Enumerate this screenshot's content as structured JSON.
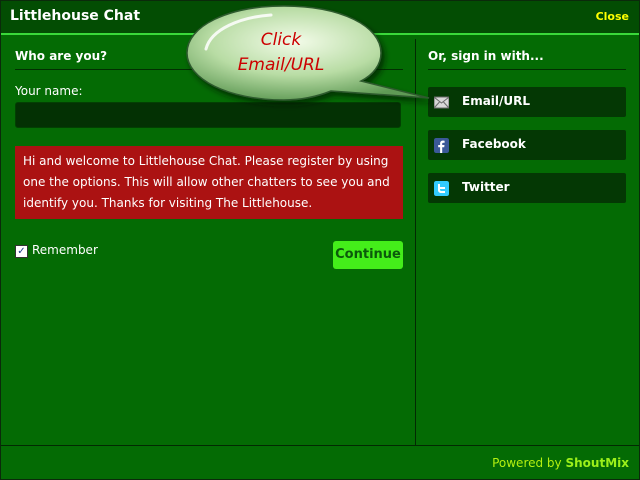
{
  "window": {
    "title": "Littlehouse Chat",
    "close_label": "Close"
  },
  "left": {
    "heading": "Who are you?",
    "name_label": "Your name:",
    "name_value": "",
    "welcome_message": "Hi and welcome to Littlehouse Chat. Please register by using one the options. This will allow other chatters to see you and identify you. Thanks for visiting The Littlehouse.",
    "remember_label": "Remember",
    "remember_checked": true,
    "continue_label": "Continue"
  },
  "right": {
    "heading": "Or, sign in with...",
    "options": [
      {
        "label": "Email/URL",
        "icon": "envelope-icon"
      },
      {
        "label": "Facebook",
        "icon": "facebook-icon"
      },
      {
        "label": "Twitter",
        "icon": "twitter-icon"
      }
    ]
  },
  "footer": {
    "powered_prefix": "Powered by",
    "brand": "ShoutMix"
  },
  "callout": {
    "line1": "Click",
    "line2": "Email/URL"
  },
  "colors": {
    "background": "#046b04",
    "titlebar": "#034d03",
    "accent_line": "#3ad93a",
    "welcome_box": "#ab1212",
    "continue_button": "#44ee1a",
    "close_link": "#ffff00",
    "footer_text": "#b4f010",
    "callout_text": "#cc0000"
  }
}
